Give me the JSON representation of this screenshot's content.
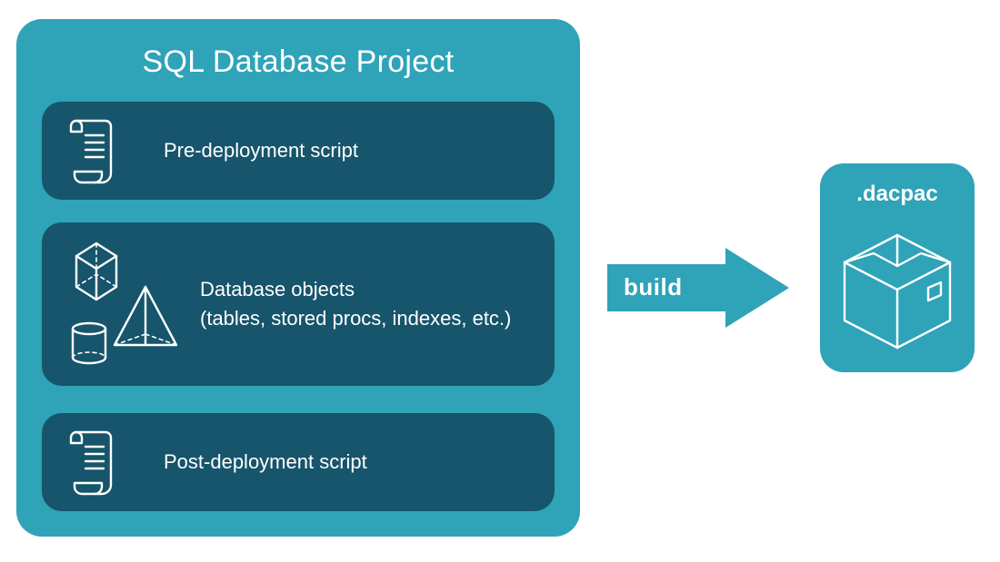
{
  "project": {
    "title": "SQL Database Project",
    "sections": {
      "pre": {
        "label": "Pre-deployment script"
      },
      "mid": {
        "label": "Database objects\n(tables, stored procs, indexes, etc.)"
      },
      "post": {
        "label": "Post-deployment script"
      }
    }
  },
  "arrow": {
    "label": "build"
  },
  "output": {
    "label": ".dacpac"
  },
  "colors": {
    "teal": "#2fa3b8",
    "tealDark": "#16556b",
    "white": "#ffffff"
  }
}
